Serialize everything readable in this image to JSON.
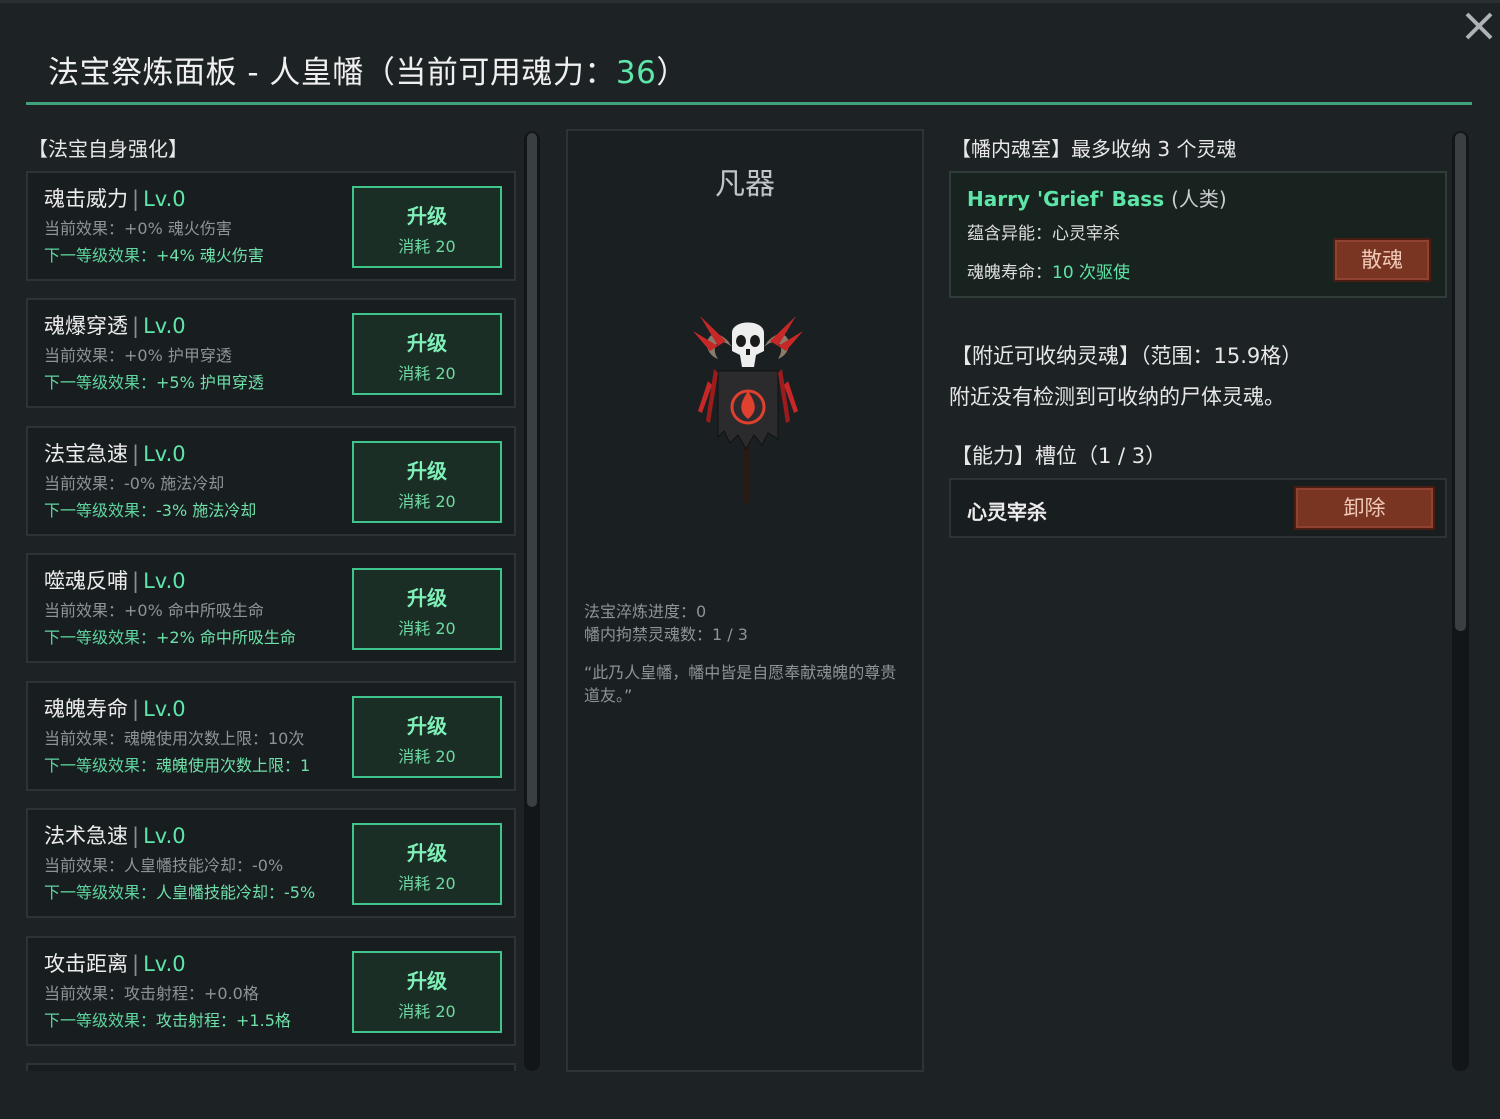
{
  "window": {
    "title_prefix": "法宝祭炼面板 - 人皇幡（当前可用魂力：",
    "soul_power": "36",
    "title_suffix": "）"
  },
  "left_section": {
    "header": "【法宝自身强化】",
    "upgrades": [
      {
        "name": "魂击威力",
        "level": "Lv.0",
        "current": "当前效果：+0% 魂火伤害",
        "next": "下一等级效果：",
        "next_value": "+4% 魂火伤害",
        "button": "升级",
        "cost": "消耗 20"
      },
      {
        "name": "魂爆穿透",
        "level": "Lv.0",
        "current": "当前效果：+0% 护甲穿透",
        "next": "下一等级效果：",
        "next_value": "+5% 护甲穿透",
        "button": "升级",
        "cost": "消耗 20"
      },
      {
        "name": "法宝急速",
        "level": "Lv.0",
        "current": "当前效果：-0% 施法冷却",
        "next": "下一等级效果：",
        "next_value": "-3% 施法冷却",
        "button": "升级",
        "cost": "消耗 20"
      },
      {
        "name": "噬魂反哺",
        "level": "Lv.0",
        "current": "当前效果：+0% 命中所吸生命",
        "next": "下一等级效果：",
        "next_value": "+2% 命中所吸生命",
        "button": "升级",
        "cost": "消耗 20"
      },
      {
        "name": "魂魄寿命",
        "level": "Lv.0",
        "current": "当前效果：魂魄使用次数上限：10次",
        "next": "下一等级效果：",
        "next_value": "魂魄使用次数上限：1",
        "button": "升级",
        "cost": "消耗 20"
      },
      {
        "name": "法术急速",
        "level": "Lv.0",
        "current": "当前效果：人皇幡技能冷却：-0%",
        "next": "下一等级效果：",
        "next_value": "人皇幡技能冷却：-5%",
        "button": "升级",
        "cost": "消耗 20"
      },
      {
        "name": "攻击距离",
        "level": "Lv.0",
        "current": "当前效果：攻击射程：+0.0格",
        "next": "下一等级效果：",
        "next_value": "攻击射程：+1.5格",
        "button": "升级",
        "cost": "消耗 20"
      }
    ]
  },
  "artifact": {
    "tier": "凡器",
    "refine_progress": "法宝淬炼进度：0",
    "souls_held": "幡内拘禁灵魂数：1 / 3",
    "quote": "“此乃人皇幡，幡中皆是自愿奉献魂魄的尊贵道友。”",
    "image": "soul-banner-icon",
    "colors": {
      "banner_red": "#c0392b",
      "flame": "#e04030",
      "skull": "#e8e8e8"
    }
  },
  "soul_room": {
    "header": "【幡内魂室】最多收纳 3 个灵魂",
    "soul": {
      "name": "Harry 'Grief' Bass",
      "race": "(人类)",
      "ability": "蕴含异能：心灵宰杀",
      "life_label": "魂魄寿命：",
      "life_value": "10 次驱使",
      "release_button": "散魂"
    }
  },
  "nearby": {
    "header": "【附近可收纳灵魂】（范围：15.9格）",
    "message": "附近没有检测到可收纳的尸体灵魂。"
  },
  "abilities": {
    "header": "【能力】槽位（1 / 3）",
    "items": [
      {
        "name": "心灵宰杀",
        "remove_button": "卸除"
      }
    ]
  },
  "colors": {
    "accent": "#5ee6a8",
    "frame": "#3fa27a",
    "danger": "#7a3522"
  }
}
